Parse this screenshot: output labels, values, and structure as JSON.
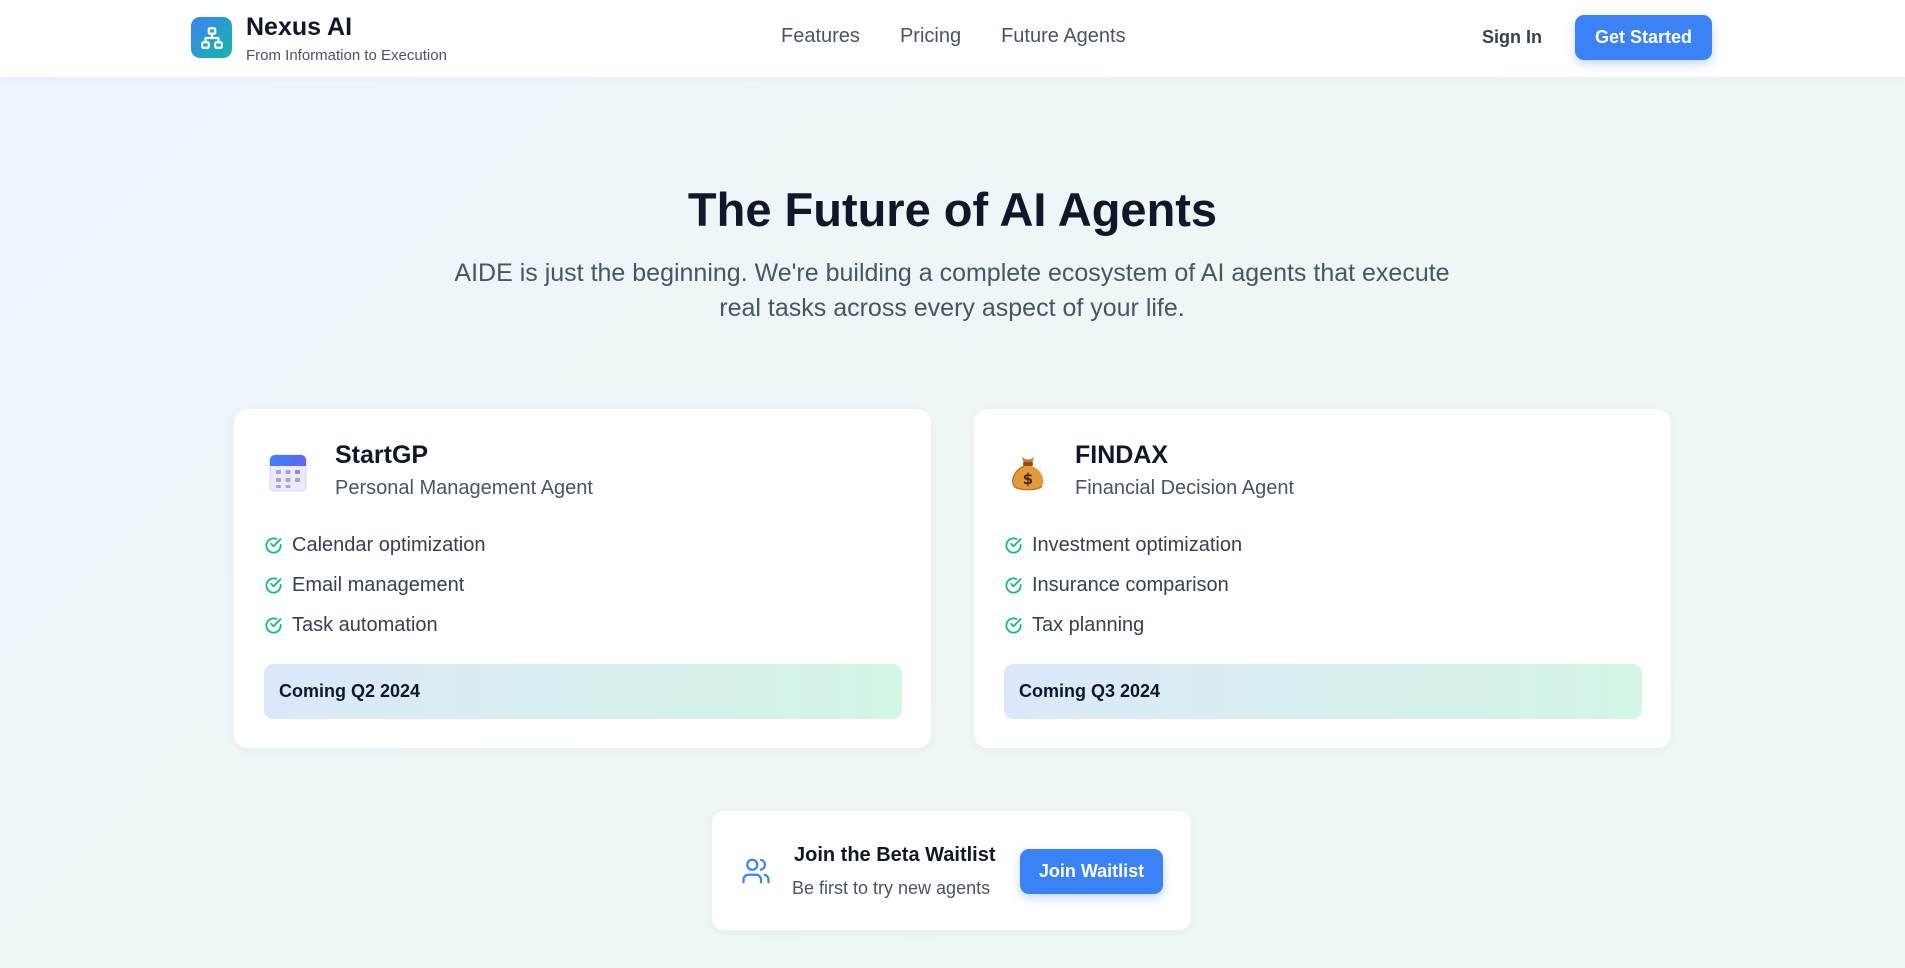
{
  "header": {
    "brand_name": "Nexus AI",
    "brand_tagline": "From Information to Execution",
    "logo_icon": "sitemap-icon",
    "nav": [
      {
        "label": "Features"
      },
      {
        "label": "Pricing"
      },
      {
        "label": "Future Agents"
      }
    ],
    "sign_in_label": "Sign In",
    "get_started_label": "Get Started"
  },
  "hero": {
    "title": "The Future of AI Agents",
    "subtitle": "AIDE is just the beginning. We're building a complete ecosystem of AI agents that execute real tasks across every aspect of your life."
  },
  "agents": [
    {
      "icon": "calendar-icon",
      "name": "StartGP",
      "subtitle": "Personal Management Agent",
      "features": [
        "Calendar optimization",
        "Email management",
        "Task automation"
      ],
      "status": "Coming Q2 2024"
    },
    {
      "icon": "money-bag-icon",
      "name": "FINDAX",
      "subtitle": "Financial Decision Agent",
      "features": [
        "Investment optimization",
        "Insurance comparison",
        "Tax planning"
      ],
      "status": "Coming Q3 2024"
    }
  ],
  "waitlist": {
    "icon": "users-icon",
    "title": "Join the Beta Waitlist",
    "subtitle": "Be first to try new agents",
    "button_label": "Join Waitlist"
  },
  "colors": {
    "accent": "#3b82f6",
    "check": "#10b981",
    "logo_gradient_start": "#3b82f6",
    "logo_gradient_end": "#14b8a6"
  }
}
